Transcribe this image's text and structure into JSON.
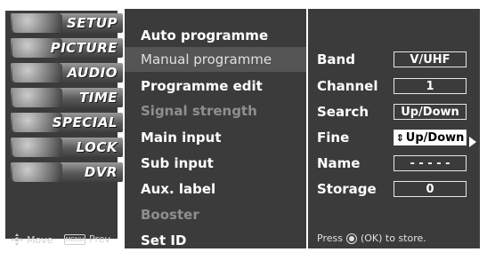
{
  "left_menu": {
    "items": [
      {
        "label": "SETUP"
      },
      {
        "label": "PICTURE"
      },
      {
        "label": "AUDIO"
      },
      {
        "label": "TIME"
      },
      {
        "label": "SPECIAL"
      },
      {
        "label": "LOCK"
      },
      {
        "label": "DVR"
      }
    ],
    "footer": {
      "move_label": "Move",
      "prev_label": "Prev",
      "menu_key_label": "MENU"
    }
  },
  "middle_menu": {
    "items": [
      {
        "label": "Auto programme"
      },
      {
        "label": "Manual programme"
      },
      {
        "label": "Programme edit"
      },
      {
        "label": "Signal strength"
      },
      {
        "label": "Main input"
      },
      {
        "label": "Sub input"
      },
      {
        "label": "Aux. label"
      },
      {
        "label": "Booster"
      },
      {
        "label": "Set ID"
      }
    ],
    "selected_index": 1
  },
  "manual_programme": {
    "rows": [
      {
        "key": "Band",
        "value": "V/UHF"
      },
      {
        "key": "Channel",
        "value": "1"
      },
      {
        "key": "Search",
        "value": "Up/Down"
      },
      {
        "key": "Fine",
        "value": "Up/Down"
      },
      {
        "key": "Name",
        "value": "- - - - -"
      },
      {
        "key": "Storage",
        "value": "0"
      }
    ],
    "hint": {
      "prefix": "Press",
      "suffix": "(OK) to store."
    }
  },
  "icons": [
    "move-icon",
    "menu-key-icon",
    "ok-button-icon",
    "updown-arrows-icon",
    "right-arrow-icon"
  ]
}
